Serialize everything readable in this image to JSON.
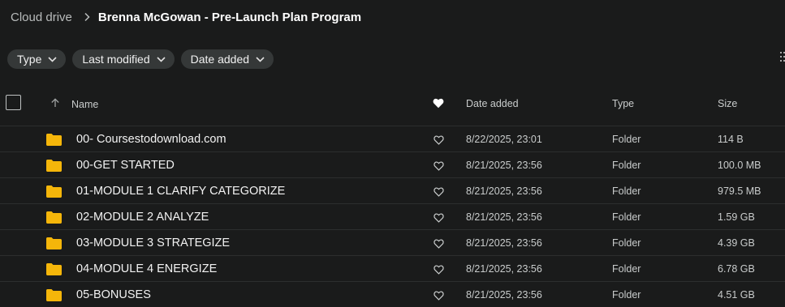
{
  "breadcrumb": {
    "root": "Cloud drive",
    "current": "Brenna McGowan - Pre-Launch Plan Program"
  },
  "filters": [
    {
      "label": "Type",
      "icon": "chevron-down-icon"
    },
    {
      "label": "Last modified",
      "icon": "chevron-down-icon"
    },
    {
      "label": "Date added",
      "icon": "chevron-down-icon"
    }
  ],
  "columns": {
    "name": "Name",
    "date_added": "Date added",
    "type": "Type",
    "size": "Size"
  },
  "colors": {
    "background": "#1a1b1b",
    "folder": "#f5b60a",
    "chip": "#353838"
  },
  "rows": [
    {
      "name": "00- Coursestodownload.com",
      "date": "8/22/2025, 23:01",
      "type": "Folder",
      "size": "114 B"
    },
    {
      "name": "00-GET STARTED",
      "date": "8/21/2025, 23:56",
      "type": "Folder",
      "size": "100.0 MB"
    },
    {
      "name": "01-MODULE 1 CLARIFY CATEGORIZE",
      "date": "8/21/2025, 23:56",
      "type": "Folder",
      "size": "979.5 MB"
    },
    {
      "name": "02-MODULE 2 ANALYZE",
      "date": "8/21/2025, 23:56",
      "type": "Folder",
      "size": "1.59 GB"
    },
    {
      "name": "03-MODULE 3 STRATEGIZE",
      "date": "8/21/2025, 23:56",
      "type": "Folder",
      "size": "4.39 GB"
    },
    {
      "name": "04-MODULE 4 ENERGIZE",
      "date": "8/21/2025, 23:56",
      "type": "Folder",
      "size": "6.78 GB"
    },
    {
      "name": "05-BONUSES",
      "date": "8/21/2025, 23:56",
      "type": "Folder",
      "size": "4.51 GB"
    }
  ]
}
